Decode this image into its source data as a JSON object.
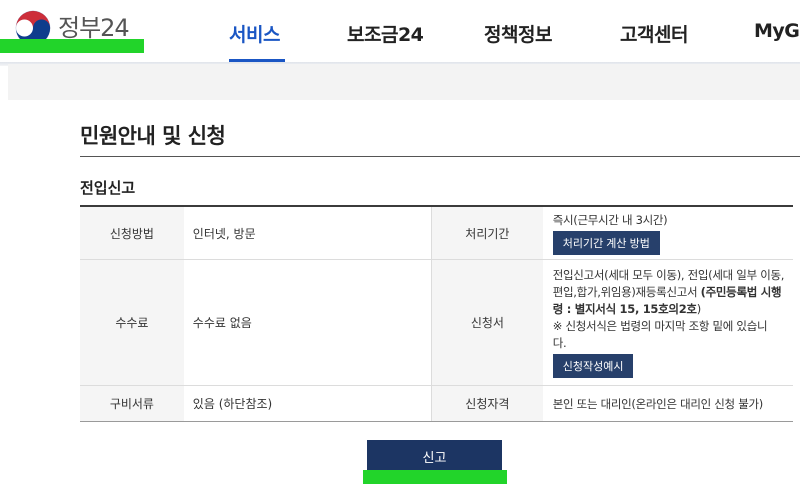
{
  "brand": {
    "logo_text": "정부24"
  },
  "nav": {
    "items": [
      {
        "label": "서비스",
        "active": true
      },
      {
        "label": "보조금24",
        "active": false
      },
      {
        "label": "정책정보",
        "active": false
      },
      {
        "label": "고객센터",
        "active": false
      },
      {
        "label": "MyG",
        "active": false
      }
    ]
  },
  "page": {
    "title": "민원안내 및 신청",
    "section_title": "전입신고"
  },
  "table": {
    "method_label": "신청방법",
    "method_value": "인터넷, 방문",
    "period_label": "처리기간",
    "period_value": "즉시(근무시간 내 3시간)",
    "period_button": "처리기간 계산 방법",
    "fee_label": "수수료",
    "fee_value": "수수료 없음",
    "form_label": "신청서",
    "form_line1": "전입신고서(세대 모두 이동), 전입(세대 일부 이동,",
    "form_line2_normal": "편입,합가,위임용)재등록신고서 ",
    "form_line2_bold": "(주민등록법 시행",
    "form_line3_bold": "령 : 별지서식 15, 15호의2호",
    "form_line3_normal": ")",
    "form_line4": "※ 신청서식은 법령의 마지막 조항 밑에 있습니",
    "form_line5": "다.",
    "form_button": "신청작성예시",
    "docs_label": "구비서류",
    "docs_value": "있음 (하단참조)",
    "eligibility_label": "신청자격",
    "eligibility_value": "본인 또는 대리인(온라인은 대리인 신청 불가)"
  },
  "submit": {
    "label": "신고"
  },
  "colors": {
    "accent": "#1a56c4",
    "button_dark": "#27406b",
    "submit": "#1c3563",
    "highlight": "#22d42a"
  }
}
